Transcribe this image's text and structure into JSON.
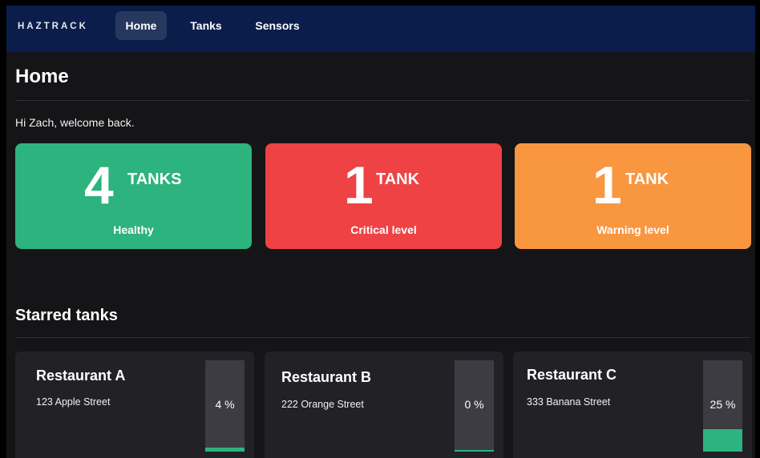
{
  "nav": {
    "brand": "HAZTRACK",
    "items": [
      {
        "label": "Home",
        "active": true
      },
      {
        "label": "Tanks",
        "active": false
      },
      {
        "label": "Sensors",
        "active": false
      }
    ]
  },
  "page": {
    "title": "Home",
    "greeting": "Hi Zach, welcome back."
  },
  "stats": [
    {
      "count": "4",
      "unit": "TANKS",
      "label": "Healthy",
      "color": "#2db37e"
    },
    {
      "count": "1",
      "unit": "TANK",
      "label": "Critical level",
      "color": "#ee4245"
    },
    {
      "count": "1",
      "unit": "TANK",
      "label": "Warning level",
      "color": "#f99640"
    }
  ],
  "starred": {
    "title": "Starred tanks",
    "tanks": [
      {
        "name": "Restaurant A",
        "address": "123 Apple Street",
        "level_text": "4 %",
        "level": 0.04
      },
      {
        "name": "Restaurant B",
        "address": "222 Orange Street",
        "level_text": "0 %",
        "level": 0.0
      },
      {
        "name": "Restaurant C",
        "address": "333 Banana Street",
        "level_text": "25 %",
        "level": 0.25
      }
    ],
    "fill_color": "#2db37e"
  },
  "colors": {
    "navbar": "#0b1e4b",
    "background": "#151517",
    "card": "#222226"
  }
}
